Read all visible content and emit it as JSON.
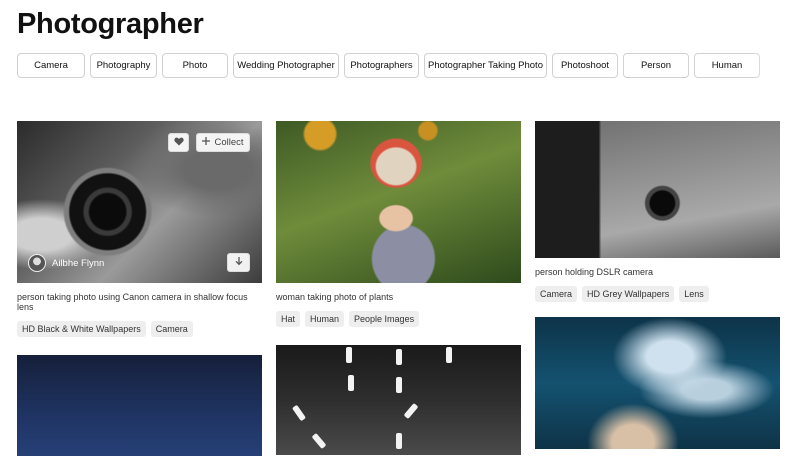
{
  "page": {
    "title": "Photographer"
  },
  "related_tags": [
    "Camera",
    "Photography",
    "Photo",
    "Wedding Photographer",
    "Photographers",
    "Photographer Taking Photo",
    "Photoshoot",
    "Person",
    "Human"
  ],
  "photos": [
    {
      "caption": "person taking photo using Canon camera in shallow focus lens",
      "tags": [
        "HD Black & White Wallpapers",
        "Camera"
      ],
      "author": "Ailbhe Flynn",
      "collect_label": "Collect"
    },
    {
      "caption": "woman taking photo of plants",
      "tags": [
        "Hat",
        "Human",
        "People Images"
      ]
    },
    {
      "caption": "person holding DSLR camera",
      "tags": [
        "Camera",
        "HD Grey Wallpapers",
        "Lens"
      ]
    }
  ],
  "icons": {
    "like": "heart-icon",
    "collect": "plus-icon",
    "download": "download-arrow-icon"
  }
}
